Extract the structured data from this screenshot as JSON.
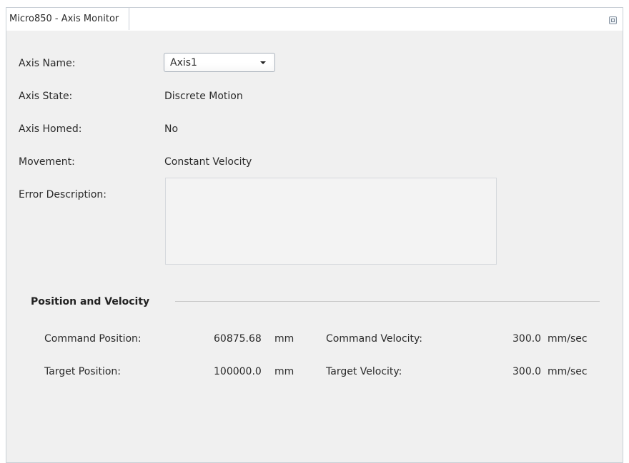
{
  "window": {
    "title": "Micro850 - Axis Monitor"
  },
  "fields": {
    "axis_name_label": "Axis Name:",
    "axis_name_value": "Axis1",
    "axis_state_label": "Axis State:",
    "axis_state_value": "Discrete Motion",
    "axis_homed_label": "Axis Homed:",
    "axis_homed_value": "No",
    "movement_label": "Movement:",
    "movement_value": "Constant Velocity",
    "error_description_label": "Error Description:",
    "error_description_value": ""
  },
  "position_velocity": {
    "section_title": "Position and Velocity",
    "command_position_label": "Command Position:",
    "command_position_value": "60875.68",
    "command_position_unit": "mm",
    "target_position_label": "Target Position:",
    "target_position_value": "100000.0",
    "target_position_unit": "mm",
    "command_velocity_label": "Command Velocity:",
    "command_velocity_value": "300.0",
    "command_velocity_unit": "mm/sec",
    "target_velocity_label": "Target Velocity:",
    "target_velocity_value": "300.0",
    "target_velocity_unit": "mm/sec"
  },
  "icons": {
    "restore": "restore-icon",
    "dropdown": "chevron-down-icon"
  }
}
